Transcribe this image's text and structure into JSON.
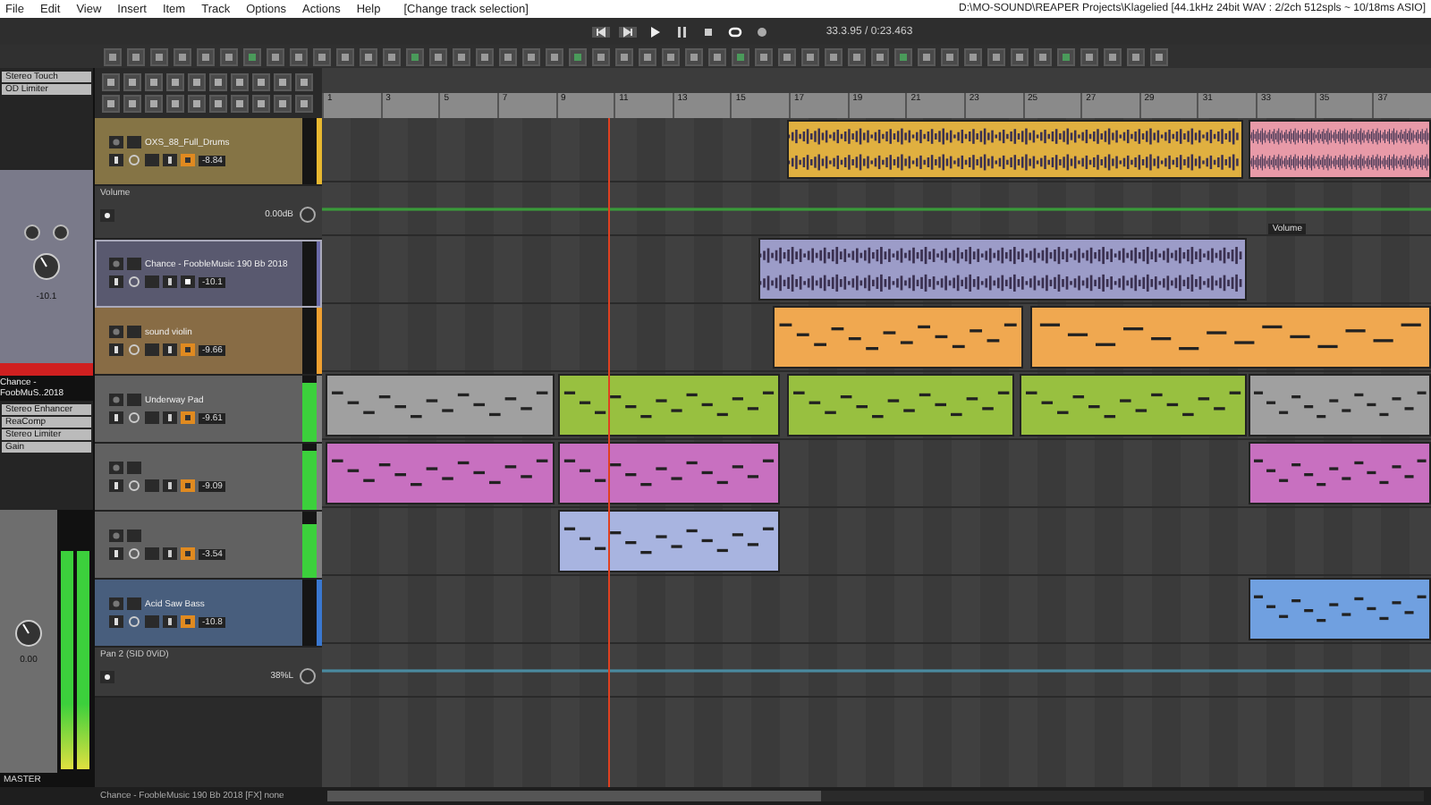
{
  "menu": [
    "File",
    "Edit",
    "View",
    "Insert",
    "Item",
    "Track",
    "Options",
    "Actions",
    "Help"
  ],
  "menu_status": "[Change track selection]",
  "window": {
    "title": "D:\\MO-SOUND\\REAPER Projects\\Klagelied [44.1kHz 24bit WAV : 2/2ch 512spls ~ 10/18ms ASIO]"
  },
  "transport": {
    "time": "33.3.95 / 0:23.463"
  },
  "mixer": {
    "fx_top": [
      "Stereo Touch",
      "OD Limiter"
    ],
    "strip_name": "Chance - FoobMuS..2018",
    "strip_volume": "-10.1",
    "fx_bottom": [
      "Stereo Enhancer",
      "ReaComp",
      "Stereo Limiter",
      "Gain"
    ],
    "master_label": "MASTER",
    "master_volume": "0.00",
    "master_meter": {
      "level": 0.85
    }
  },
  "ruler": [
    "1",
    "3",
    "5",
    "7",
    "9",
    "11",
    "13",
    "15",
    "17",
    "19",
    "21",
    "23",
    "25",
    "27",
    "29",
    "31",
    "33",
    "35",
    "37"
  ],
  "lanes": [
    {
      "kind": "track",
      "name": "OXS_88_Full_Drums",
      "reading": "-8.84",
      "selected": false,
      "monitor": true,
      "color": "#e8b830",
      "clips": [
        {
          "kind": "audio",
          "color": "#e0b040"
        },
        {
          "kind": "audio",
          "color": "#e89aa8"
        }
      ]
    },
    {
      "kind": "envelope",
      "name": "Volume",
      "reading": "0.00dB",
      "color": "#3a9a3a",
      "lane_label": "Volume"
    },
    {
      "kind": "track",
      "name": "Chance - FoobleMusic 190 Bb 2018",
      "reading": "-10.1",
      "selected": true,
      "monitor": false,
      "color": "#6a6aa8",
      "clips": [
        {
          "kind": "audio",
          "color": "#9c9cc8"
        }
      ]
    },
    {
      "kind": "track",
      "name": "sound violin",
      "reading": "-9.66",
      "selected": false,
      "monitor": true,
      "color": "#f0a030",
      "clips": [
        {
          "kind": "midi",
          "color": "#f0a850"
        },
        {
          "kind": "midi",
          "color": "#f0a850"
        }
      ]
    },
    {
      "kind": "track",
      "name": "Underway Pad",
      "reading": "-9.61",
      "selected": false,
      "monitor": true,
      "color": "#808080",
      "level": 0.9,
      "clips": [
        {
          "kind": "midi",
          "color": "#a0a0a0"
        },
        {
          "kind": "midi",
          "color": "#98c040"
        },
        {
          "kind": "midi",
          "color": "#98c040"
        },
        {
          "kind": "midi",
          "color": "#98c040"
        },
        {
          "kind": "midi",
          "color": "#a0a0a0"
        }
      ]
    },
    {
      "kind": "track",
      "reading": "-9.09",
      "selected": false,
      "monitor": true,
      "color": "#808080",
      "level": 0.9,
      "clips": [
        {
          "kind": "midi",
          "color": "#c870c0"
        },
        {
          "kind": "midi",
          "color": "#c870c0"
        },
        {
          "kind": "midi",
          "color": "#c870c0"
        }
      ]
    },
    {
      "kind": "track",
      "reading": "-3.54",
      "selected": false,
      "monitor": true,
      "color": "#808080",
      "level": 0.8,
      "clips": [
        {
          "kind": "midi",
          "color": "#a8b4e0"
        }
      ]
    },
    {
      "kind": "track",
      "name": "Acid Saw Bass",
      "reading": "-10.8",
      "selected": false,
      "monitor": true,
      "color": "#3a78d0",
      "clips": [
        {
          "kind": "midi",
          "color": "#70a0e0"
        }
      ]
    },
    {
      "kind": "envelope",
      "name": "Pan 2 (SID 0ViD)",
      "reading": "38%L",
      "color": "#4a8aa0"
    }
  ],
  "status_bar": "Chance - FoobleMusic 190 Bb 2018 [FX] none"
}
